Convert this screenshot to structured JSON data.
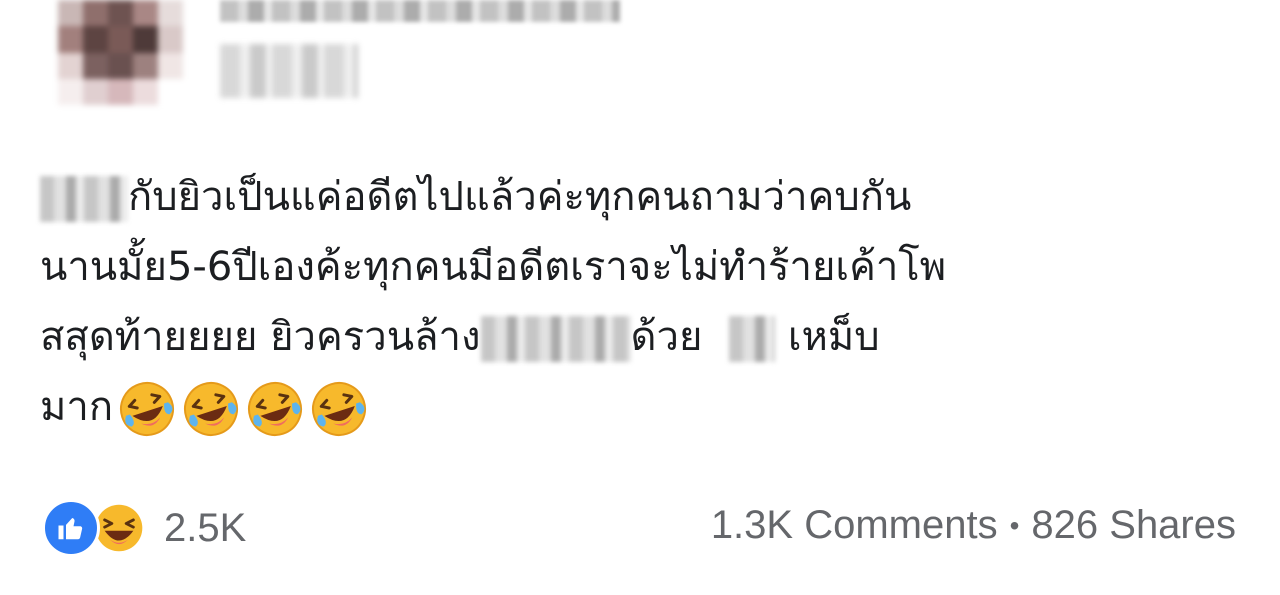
{
  "post": {
    "line1": "กับยิวเป็นแค่อดีตไปแล้วค่ะทุกคนถามว่าคบกัน",
    "line2": "นานมั้ย5-6ปีเองค้ะทุกคนมีอดีตเราจะไม่ทำร้ายเค้าโพ",
    "line3a": "สสุดท้ายยยย ยิวครวนล้าง",
    "line3b": "ด้วย",
    "line3c": "เหม็บ",
    "line4": "มาก",
    "emoji_count": 4
  },
  "reactions": {
    "count": "2.5K",
    "icons": [
      "like-icon",
      "haha-icon"
    ],
    "like_color": "#2f7df6"
  },
  "stats": {
    "comments": "1.3K Comments",
    "separator": "•",
    "shares": "826 Shares"
  }
}
